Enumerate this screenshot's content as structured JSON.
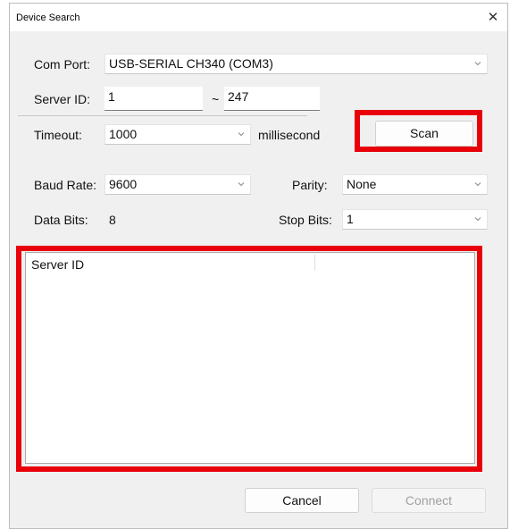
{
  "window": {
    "title": "Device Search",
    "close_glyph": "✕"
  },
  "form": {
    "com_port": {
      "label": "Com Port:",
      "value": "USB-SERIAL CH340 (COM3)"
    },
    "server_id": {
      "label": "Server ID:",
      "from": "1",
      "separator": "~",
      "to": "247"
    },
    "timeout": {
      "label": "Timeout:",
      "value": "1000",
      "unit": "millisecond"
    },
    "baud_rate": {
      "label": "Baud Rate:",
      "value": "9600"
    },
    "parity": {
      "label": "Parity:",
      "value": "None"
    },
    "data_bits": {
      "label": "Data Bits:",
      "value": "8"
    },
    "stop_bits": {
      "label": "Stop Bits:",
      "value": "1"
    }
  },
  "buttons": {
    "scan": "Scan",
    "cancel": "Cancel",
    "connect": "Connect"
  },
  "results": {
    "columns": [
      "Server ID",
      ""
    ],
    "rows": []
  },
  "colors": {
    "highlight": "#e8000b",
    "dialog_bg": "#f0f0f0",
    "disabled_text": "#a0a0a0"
  },
  "icons": {
    "dropdown": "chevron-down-icon",
    "close": "close-icon"
  }
}
